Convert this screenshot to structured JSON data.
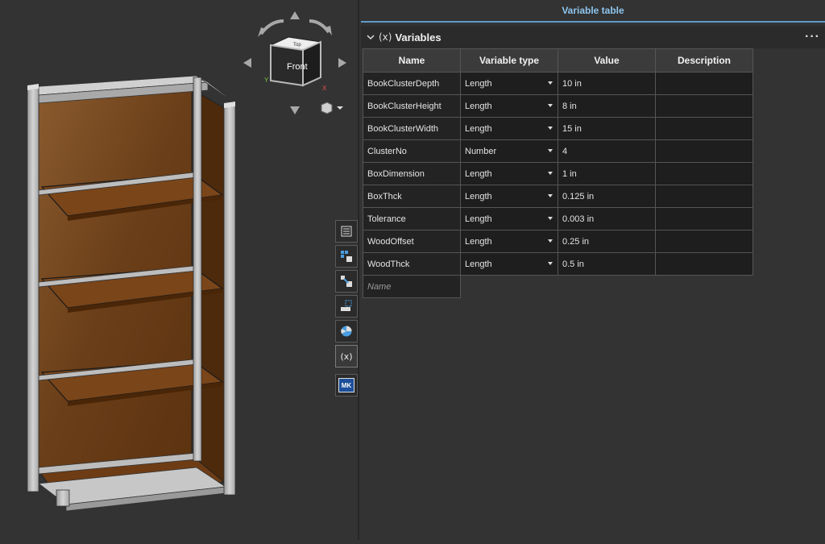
{
  "viewcube": {
    "face_front": "Front",
    "face_top": "Top",
    "axis_x": "X",
    "axis_y": "Y"
  },
  "toolbar": {
    "items": [
      "table-icon",
      "parts-icon",
      "mate-icon",
      "selection-icon",
      "appearance-icon",
      "variables-icon",
      "mk-app-icon"
    ],
    "mk_label": "MK"
  },
  "panel": {
    "title": "Variable table",
    "section_title": "Variables",
    "more": "···"
  },
  "table": {
    "headers": [
      "Name",
      "Variable type",
      "Value",
      "Description"
    ],
    "rows": [
      {
        "name": "BookClusterDepth",
        "type": "Length",
        "value": "10 in",
        "description": ""
      },
      {
        "name": "BookClusterHeight",
        "type": "Length",
        "value": "8 in",
        "description": ""
      },
      {
        "name": "BookClusterWidth",
        "type": "Length",
        "value": "15 in",
        "description": ""
      },
      {
        "name": "ClusterNo",
        "type": "Number",
        "value": "4",
        "description": ""
      },
      {
        "name": "BoxDimension",
        "type": "Length",
        "value": "1 in",
        "description": ""
      },
      {
        "name": "BoxThck",
        "type": "Length",
        "value": "0.125 in",
        "description": ""
      },
      {
        "name": "Tolerance",
        "type": "Length",
        "value": "0.003 in",
        "description": ""
      },
      {
        "name": "WoodOffset",
        "type": "Length",
        "value": "0.25 in",
        "description": ""
      },
      {
        "name": "WoodThck",
        "type": "Length",
        "value": "0.5 in",
        "description": ""
      }
    ],
    "new_row_placeholder": "Name"
  },
  "colors": {
    "accent": "#5d9ccb",
    "wood": "#6b3a12",
    "frame": "#b8b8b8"
  }
}
